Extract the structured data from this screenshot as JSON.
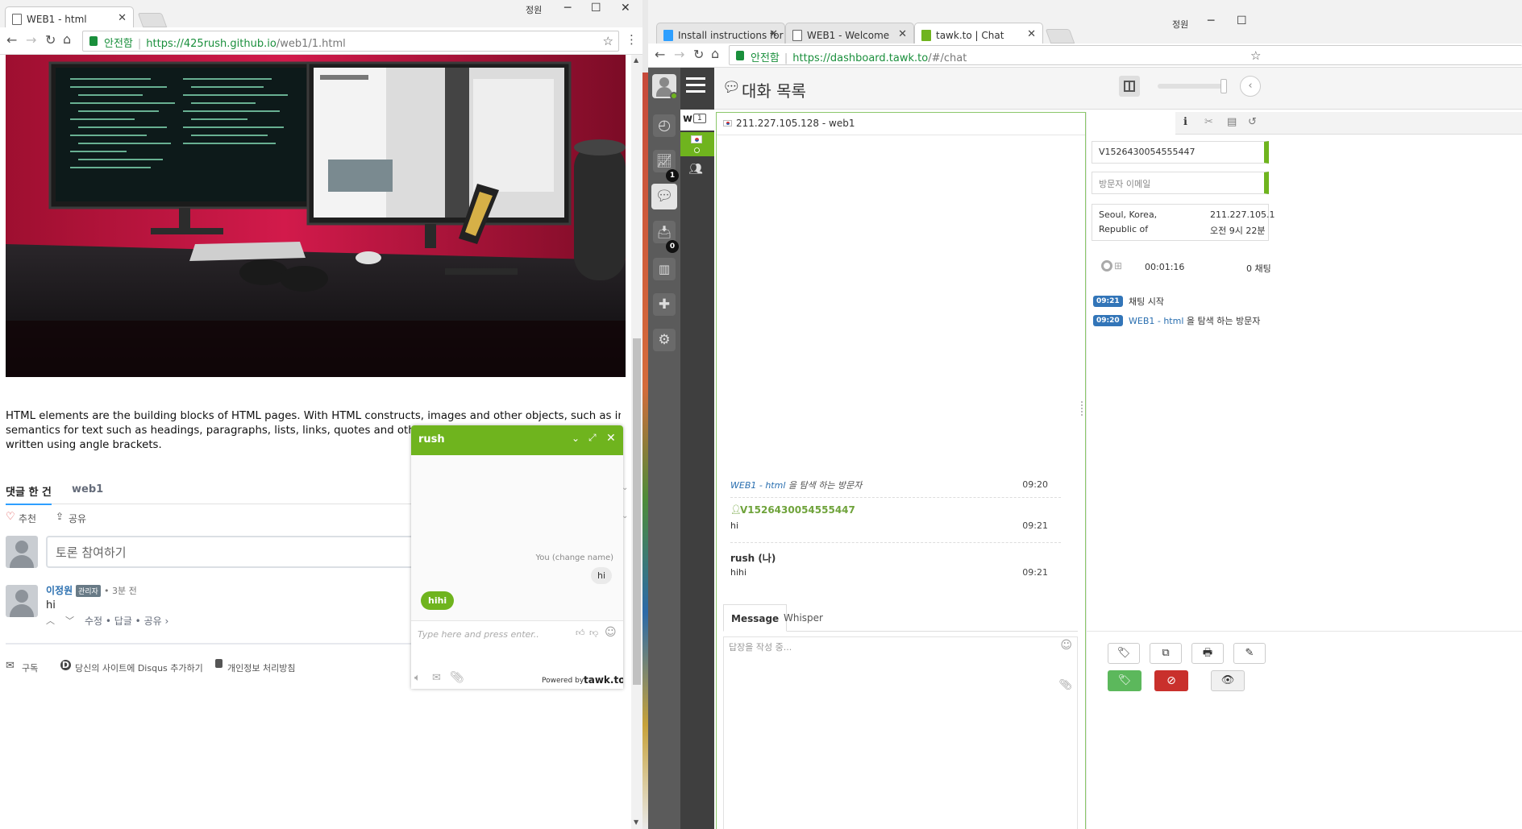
{
  "left": {
    "tab_title": "WEB1 - html",
    "profile": "정원",
    "secure_label": "안전함",
    "url_host": "https://425rush.github.io",
    "url_path": "/web1/1.html",
    "paragraph": "HTML elements are the building blocks of HTML pages. With HTML constructs, images and other objects, such as interactive forms, may be embedded into the rendered page. It provides a means to create st",
    "paragraph_l2_tail": "semantics for text such as headings, paragraphs, lists, links, quotes and other items",
    "paragraph_l3": "written using angle brackets.",
    "disqus": {
      "tab_comments": "댓글 한 건",
      "tab_site": "web1",
      "recommend": "추천",
      "share": "공유",
      "input_placeholder": "토론 참여하기",
      "comment_author": "이정원",
      "comment_badge": "관리자",
      "comment_time": "• 3분 전",
      "comment_text": "hi",
      "comment_actions": "수정 • 답글 • 공유 ›",
      "footer_subscribe": "구독",
      "footer_add": "당신의 사이트에 Disqus 추가하기",
      "footer_privacy": "개인정보 처리방침"
    },
    "widget": {
      "agent": "rush",
      "you_label": "You (change name)",
      "msg_visitor": "hi",
      "msg_agent": "hihi",
      "input_placeholder": "Type here and press enter..",
      "powered_prefix": "Powered by",
      "powered_brand": "tawk.to",
      "accent": "#6fb41e"
    }
  },
  "right": {
    "tabs": [
      {
        "label": "Install instructions for U"
      },
      {
        "label": "WEB1 - Welcome"
      },
      {
        "label": "tawk.to | Chat"
      }
    ],
    "profile": "정원",
    "secure_label": "안전함",
    "url_host": "https://dashboard.tawk.to",
    "url_path": "/#/chat",
    "header_title": "대화 목록",
    "sidebar_badges": {
      "monitor": "1",
      "inbox": "0"
    },
    "chat_list_count": "1",
    "chat_list_letter": "w",
    "chat_header": "211.227.105.128 - web1",
    "visitor_id": "V1526430054555447",
    "visitor_email_placeholder": "방문자 이메일",
    "location_line1": "Seoul, Korea,",
    "location_line2": "Republic of",
    "ip_display": "211.227.105.1",
    "local_time": "오전 9시 22분",
    "duration": "00:01:16",
    "chat_count": "0 채팅",
    "timeline": [
      {
        "time": "09:21",
        "text": "채팅 시작"
      },
      {
        "time": "09:20",
        "link": "WEB1 - html",
        "text": " 을 탐색 하는 방문자"
      }
    ],
    "messages": {
      "nav_link": "WEB1 - html",
      "nav_suffix": " 을 탐색 하는 방문자",
      "nav_time": "09:20",
      "visitor_name": "V1526430054555447",
      "visitor_text": "hi",
      "visitor_time": "09:21",
      "agent_name": "rush (나)",
      "agent_text": "hihi",
      "agent_time": "09:21"
    },
    "reply_tabs": {
      "message": "Message",
      "whisper": "Whisper"
    },
    "reply_placeholder": "답장을 작성 중..."
  }
}
